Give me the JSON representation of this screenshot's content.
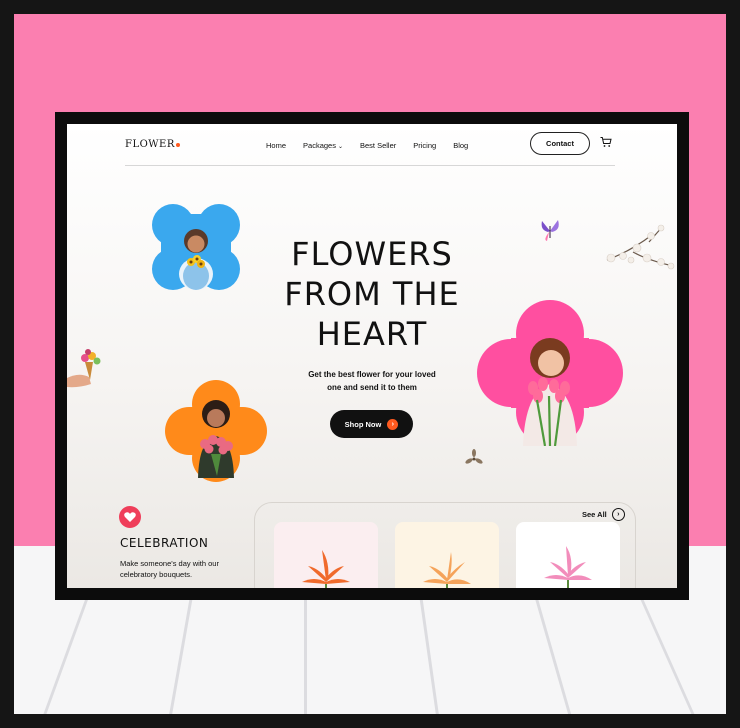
{
  "brand": {
    "name": "FLOWER",
    "dot_color": "#ff5a1f"
  },
  "nav": {
    "items": [
      {
        "label": "Home"
      },
      {
        "label": "Packages"
      },
      {
        "label": "Best Seller"
      },
      {
        "label": "Pricing"
      },
      {
        "label": "Blog"
      }
    ],
    "contact_label": "Contact"
  },
  "hero": {
    "title_lines": [
      "FLOWERS",
      "FROM THE",
      "HEART"
    ],
    "subtitle_lines": [
      "Get the best flower for your loved",
      "one and send it to them"
    ],
    "cta_label": "Shop Now"
  },
  "section": {
    "title": "CELEBRATION",
    "description": "Make someone's day with our celebratory bouquets.",
    "see_all_label": "See All"
  },
  "colors": {
    "wall": "#fb7fb0",
    "accent": "#ff5a1f",
    "clover_blue": "#3aa8ee",
    "clover_pink": "#ff4fa0",
    "clover_orange": "#ff8a1a",
    "card_1": "#fbeef0",
    "card_2": "#fdf4e4",
    "card_3": "#ffffff"
  },
  "icons": [
    "cart-icon",
    "chevron-down-icon",
    "arrow-right-icon",
    "heart-icon",
    "butterfly-icon",
    "flower-branch-icon"
  ]
}
